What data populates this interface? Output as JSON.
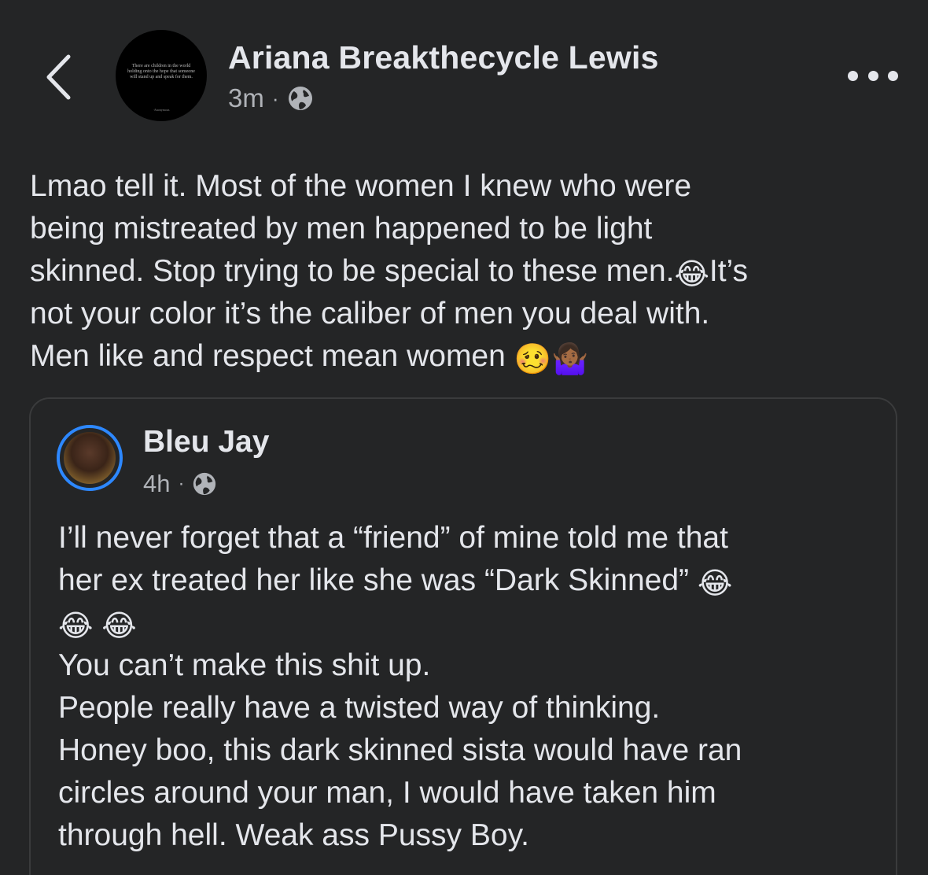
{
  "header": {
    "back_icon": "chevron-left-icon",
    "author": {
      "name": "Ariana Breakthecycle Lewis",
      "time": "3m",
      "separator": "·",
      "audience_icon": "globe-icon",
      "avatar_quote": "There are children in the world holding onto the hope that someone will stand up and speak for them.",
      "avatar_signature": "·Anonymous"
    },
    "more_icon": "more-options-icon"
  },
  "post": {
    "lines": [
      "Lmao tell it. Most of the women I knew who were",
      "being mistreated by men happened to be light",
      "skinned. Stop trying to be special to these men.",
      "not your color it’s the caliber of men you deal with.",
      "Men like and respect mean women"
    ],
    "line3_after_emoji": "It’s",
    "emojis": {
      "laughing": "😂",
      "woozy": "🥴",
      "shrug": "🤷🏾‍♀️"
    }
  },
  "shared_post": {
    "author": {
      "name": "Bleu Jay",
      "time": "4h",
      "separator": "·",
      "audience_icon": "globe-icon"
    },
    "lines": [
      "I’ll never forget that a “friend” of mine told me that",
      "her ex treated her like she was “Dark Skinned”",
      "",
      "You can’t make this shit up.",
      "People really have a twisted way of thinking.",
      "Honey boo, this dark skinned sista would have ran",
      "circles around your man, I would have taken him",
      "through hell. Weak ass Pussy Boy."
    ],
    "emojis": {
      "laughing": "😂"
    }
  },
  "colors": {
    "background": "#242526",
    "text_primary": "#e4e6eb",
    "text_secondary": "#b0b3b8",
    "card_border": "#3a3b3c",
    "avatar_ring": "#2d88ff"
  }
}
